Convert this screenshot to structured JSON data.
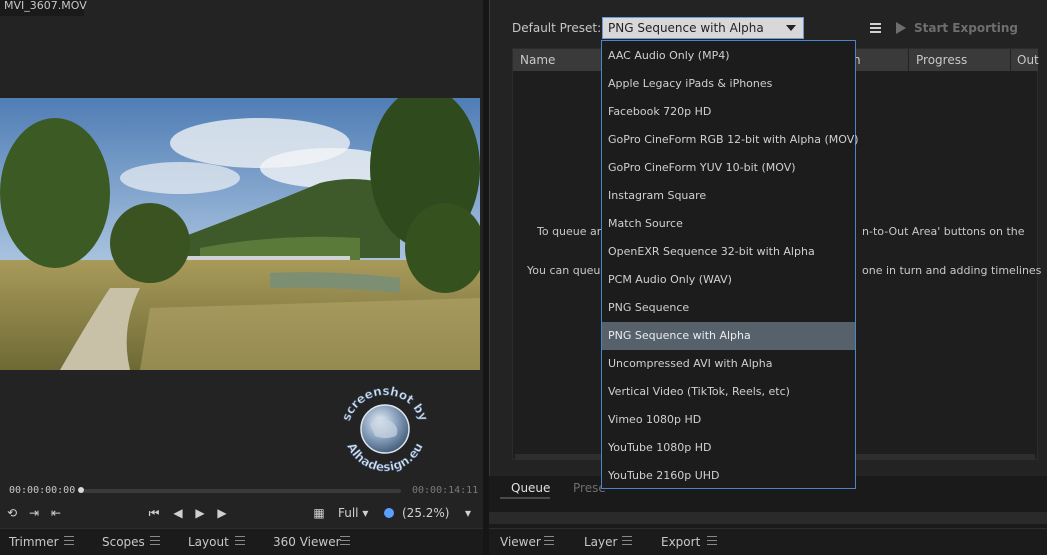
{
  "clip": {
    "filename": "MVI_3607.MOV"
  },
  "player": {
    "timecode_current": "00:00:00:00",
    "timecode_end": "00:00:14:11",
    "resolution": "Full",
    "zoom": "(25.2%)"
  },
  "left_tabs": [
    "Trimmer",
    "Scopes",
    "Layout",
    "360 Viewer"
  ],
  "export": {
    "default_preset_label": "Default Preset:",
    "selected_preset": "PNG Sequence with Alpha",
    "start_exporting": "Start Exporting",
    "columns": [
      "Name",
      "n",
      "Progress",
      "Out"
    ],
    "hint_line1_left": "To queue an",
    "hint_line1_right": "n-to-Out Area' buttons on the",
    "hint_line2_left": "You can queue",
    "hint_line2_right": "one in turn and adding timelines",
    "tabs": [
      "Queue",
      "Prese"
    ]
  },
  "preset_options": [
    "AAC Audio Only (MP4)",
    "Apple Legacy iPads & iPhones",
    "Facebook 720p HD",
    "GoPro CineForm RGB 12-bit with Alpha (MOV)",
    "GoPro CineForm YUV 10-bit (MOV)",
    "Instagram Square",
    "Match Source",
    "OpenEXR Sequence 32-bit with Alpha",
    "PCM Audio Only (WAV)",
    "PNG Sequence",
    "PNG Sequence with Alpha",
    "Uncompressed AVI with Alpha",
    "Vertical Video (TikTok, Reels, etc)",
    "Vimeo 1080p HD",
    "YouTube 1080p HD",
    "YouTube 2160p UHD"
  ],
  "selected_index": 10,
  "right_tabs": [
    "Viewer",
    "Layer",
    "Export"
  ],
  "watermark": {
    "text_top": "screenshot by",
    "text_bottom": "Alhadesign.eu"
  },
  "colors": {
    "accent": "#4b86c6",
    "selected_row": "#56616c",
    "zoom_dot": "#5aa0ff"
  }
}
